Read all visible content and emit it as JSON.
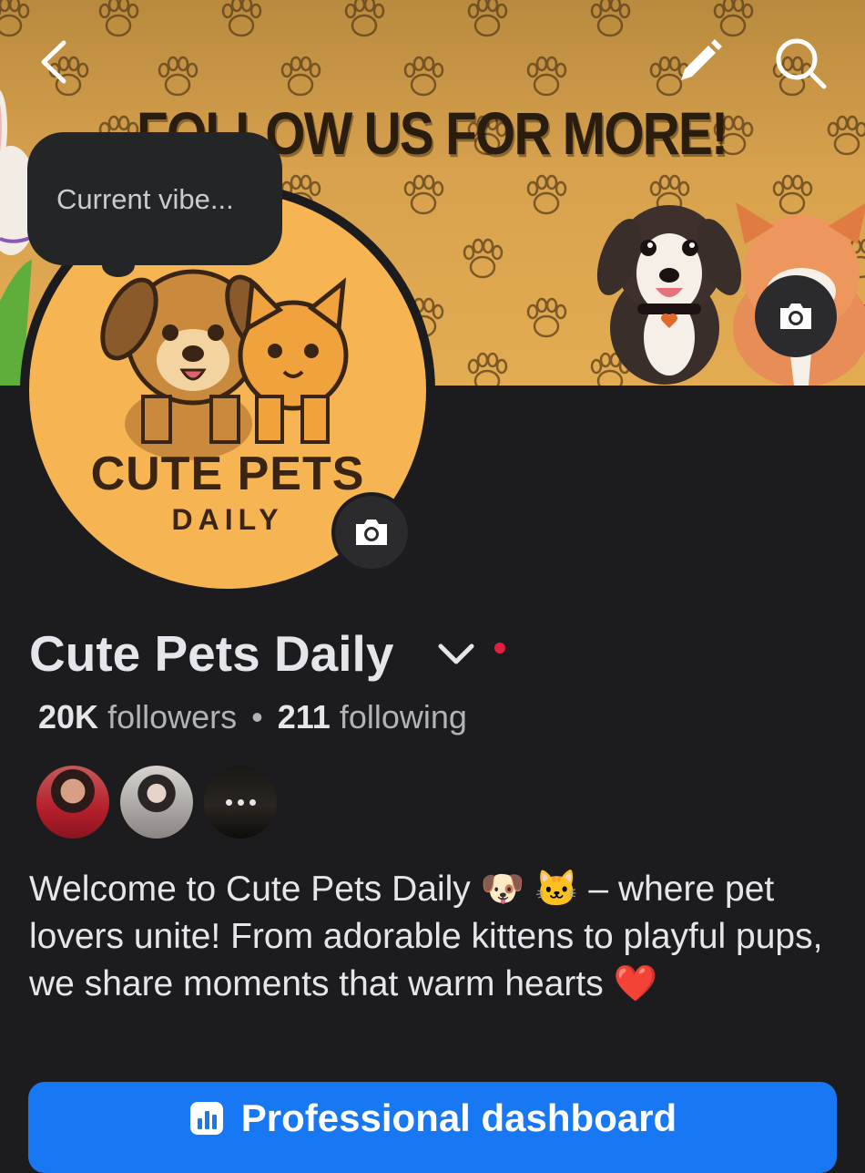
{
  "cover": {
    "banner_text": "FOLLOW US FOR MORE!"
  },
  "nav": {
    "back_icon": "chevron-left-icon",
    "edit_icon": "pencil-icon",
    "search_icon": "search-icon"
  },
  "status_bubble": {
    "text": "Current vibe..."
  },
  "avatar": {
    "title": "CUTE PETS",
    "subtitle": "DAILY"
  },
  "profile": {
    "name": "Cute Pets Daily",
    "followers_count": "20K",
    "followers_label": "followers",
    "separator": "•",
    "following_count": "211",
    "following_label": "following",
    "bio": "Welcome to Cute Pets Daily 🐶 🐱 – where pet lovers unite! From adorable kittens to playful pups, we share moments that warm hearts ❤️"
  },
  "actions": {
    "professional_dashboard": "Professional dashboard"
  },
  "colors": {
    "background": "#1c1c1e",
    "primary_button": "#1877f2",
    "status_dot": "#e41e3f",
    "avatar_bg": "#f6b552"
  }
}
